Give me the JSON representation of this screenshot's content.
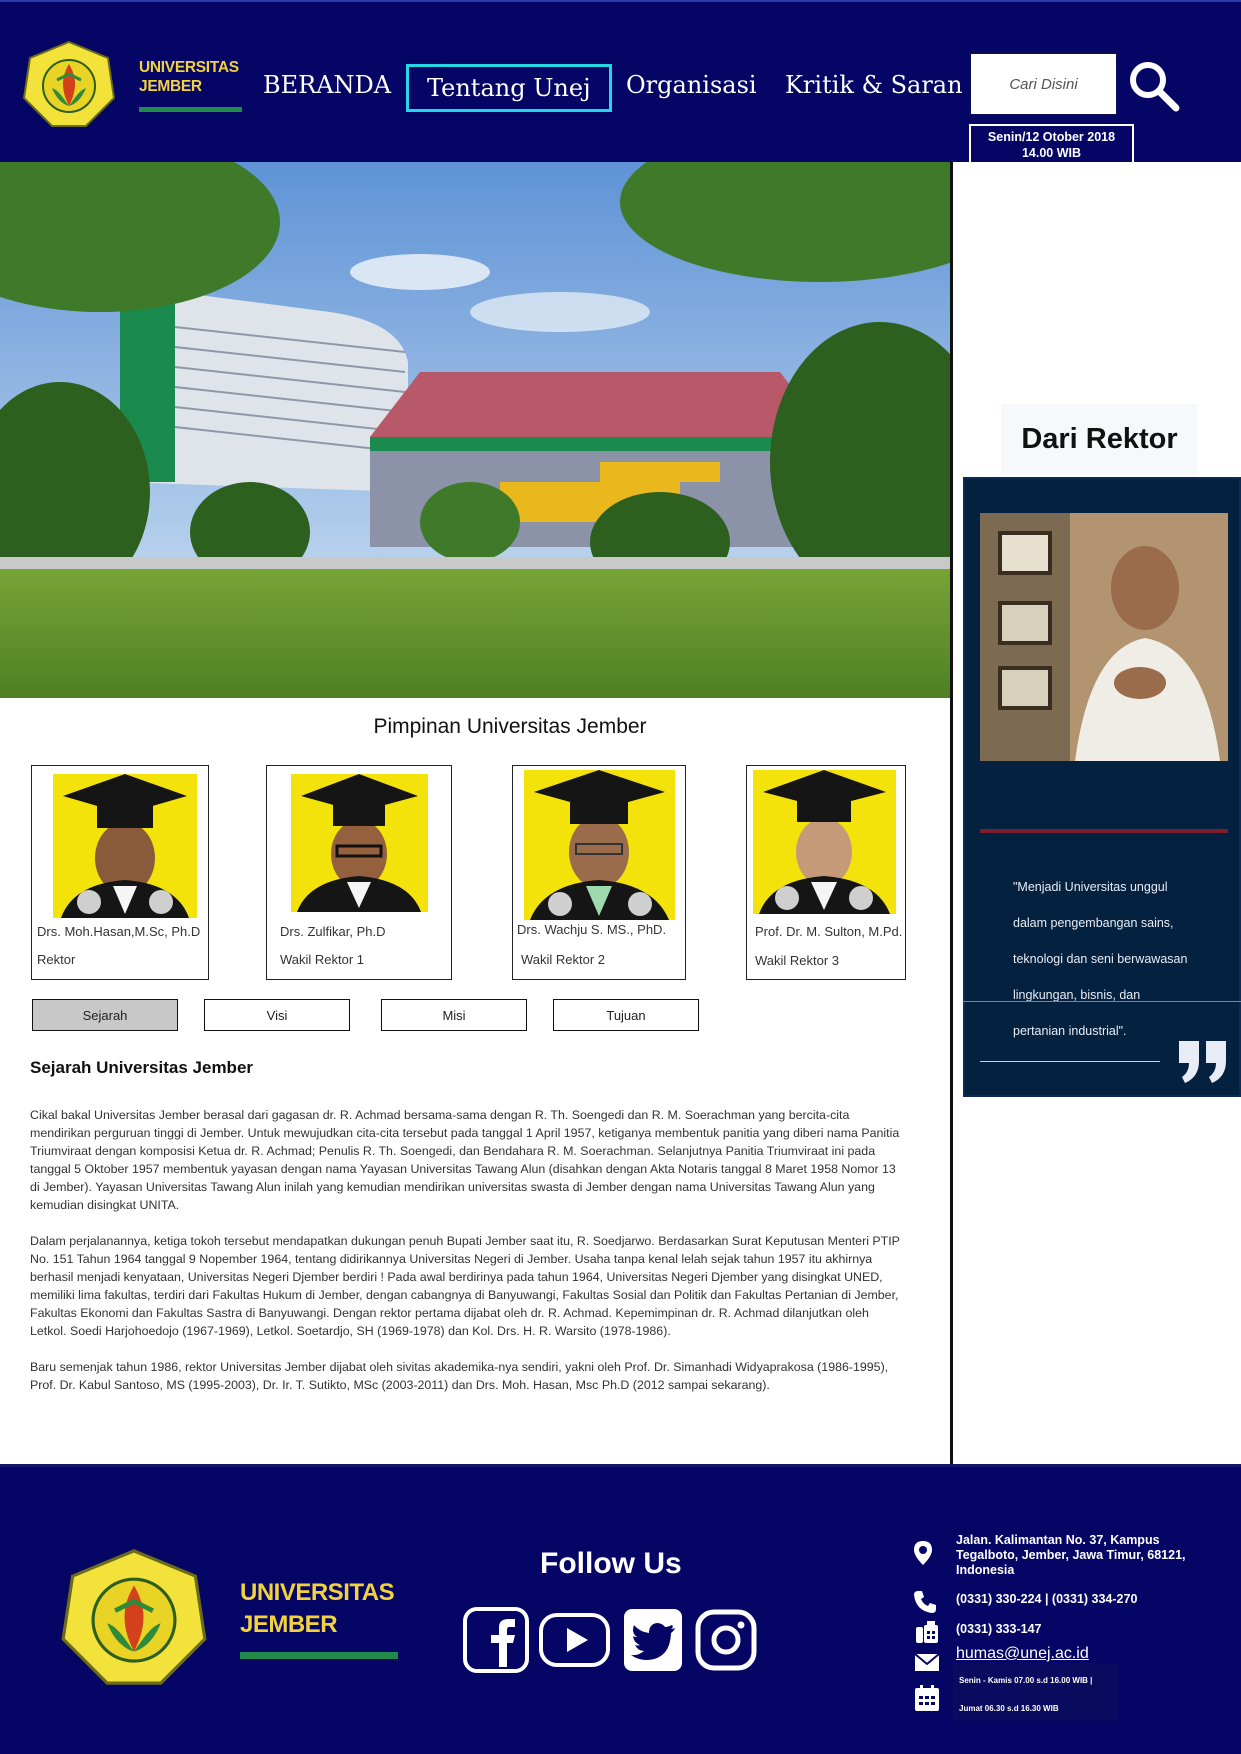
{
  "header": {
    "logo_text_line1": "UNIVERSITAS",
    "logo_text_line2": "JEMBER",
    "nav": [
      "BERANDA",
      "Tentang Unej",
      "Organisasi",
      "Kritik & Saran"
    ],
    "active_nav": "Tentang Unej",
    "search_placeholder": "Cari Disini",
    "date_line1": "Senin/12 Otober 2018",
    "date_line2": "14.00 WIB"
  },
  "main": {
    "section_title": "Pimpinan Universitas Jember",
    "leaders": [
      {
        "name": "Drs. Moh.Hasan,M.Sc, Ph.D",
        "role": "Rektor"
      },
      {
        "name": "Drs. Zulfikar, Ph.D",
        "role": "Wakil Rektor 1"
      },
      {
        "name": "Drs. Wachju S. MS., PhD.",
        "role": "Wakil Rektor 2"
      },
      {
        "name": "Prof. Dr. M. Sulton, M.Pd.",
        "role": "Wakil Rektor 3"
      }
    ],
    "tabs": [
      "Sejarah",
      "Visi",
      "Misi",
      "Tujuan"
    ],
    "active_tab": "Sejarah",
    "history_title": "Sejarah Universitas Jember",
    "history_paragraphs": [
      "Cikal bakal Universitas Jember berasal dari gagasan dr. R. Achmad bersama-sama dengan R. Th. Soengedi dan R. M. Soerachman yang bercita-cita mendirikan perguruan tinggi di Jember. Untuk mewujudkan cita-cita tersebut pada tanggal 1 April 1957, ketiganya membentuk panitia yang diberi nama Panitia Triumviraat dengan komposisi Ketua dr. R. Achmad; Penulis R. Th. Soengedi, dan Bendahara R. M. Soerachman. Selanjutnya Panitia Triumviraat ini pada tanggal 5 Oktober 1957 membentuk yayasan dengan nama Yayasan Universitas Tawang Alun (disahkan dengan Akta Notaris tanggal 8 Maret 1958 Nomor 13 di Jember). Yayasan Universitas Tawang Alun inilah yang kemudian mendirikan universitas swasta di Jember dengan nama Universitas Tawang Alun yang kemudian disingkat UNITA.",
      "Dalam perjalanannya, ketiga tokoh tersebut mendapatkan dukungan penuh Bupati Jember saat itu, R. Soedjarwo. Berdasarkan Surat Keputusan Menteri PTIP No. 151 Tahun 1964 tanggal 9 Nopember 1964, tentang didirikannya Universitas Negeri di Jember. Usaha tanpa kenal lelah sejak tahun 1957 itu akhirnya berhasil menjadi kenyataan, Universitas Negeri Djember berdiri ! Pada awal berdirinya pada tahun 1964, Universitas Negeri Djember yang disingkat UNED, memiliki lima fakultas, terdiri dari Fakultas Hukum di Jember, dengan cabangnya di Banyuwangi, Fakultas Sosial dan Politik dan Fakultas Pertanian di Jember, Fakultas Ekonomi dan Fakultas Sastra di Banyuwangi. Dengan rektor pertama dijabat oleh dr. R. Achmad. Kepemimpinan dr. R. Achmad dilanjutkan oleh Letkol. Soedi Harjohoedojo (1967-1969), Letkol. Soetardjo, SH (1969-1978) dan Kol. Drs. H. R. Warsito (1978-1986).",
      "Baru semenjak tahun 1986, rektor Universitas Jember dijabat oleh sivitas akademika-nya sendiri, yakni oleh Prof. Dr. Simanhadi Widyaprakosa (1986-1995), Prof. Dr. Kabul Santoso, MS (1995-2003), Dr. Ir. T. Sutikto, MSc (2003-2011) dan Drs. Moh. Hasan, Msc Ph.D (2012 sampai sekarang)."
    ]
  },
  "sidebar": {
    "heading": "Dari Rektor",
    "quote_lines": [
      "\"Menjadi Universitas unggul",
      "dalam pengembangan sains,",
      "teknologi dan seni berwawasan",
      "lingkungan, bisnis, dan",
      "pertanian industrial\"."
    ]
  },
  "footer": {
    "logo_text_line1": "UNIVERSITAS",
    "logo_text_line2": "JEMBER",
    "follow_title": "Follow Us",
    "social": [
      "facebook-icon",
      "youtube-icon",
      "twitter-icon",
      "instagram-icon"
    ],
    "address": "Jalan. Kalimantan No. 37, Kampus Tegalboto, Jember, Jawa Timur, 68121, Indonesia",
    "phone": "(0331) 330-224 | (0331) 334-270",
    "fax": "(0331) 333-147",
    "email": "humas@unej.ac.id",
    "hours_line1": "Senin - Kamis 07.00 s.d 16.00 WIB |",
    "hours_line2": "Jumat 06.30 s.d 16.30 WIB"
  },
  "colors": {
    "navy": "#050566",
    "logo_yellow": "#f2d23d",
    "logo_green": "#1f8a4c",
    "active_nav_border": "#27d6e6",
    "panel_navy": "#04213f"
  }
}
